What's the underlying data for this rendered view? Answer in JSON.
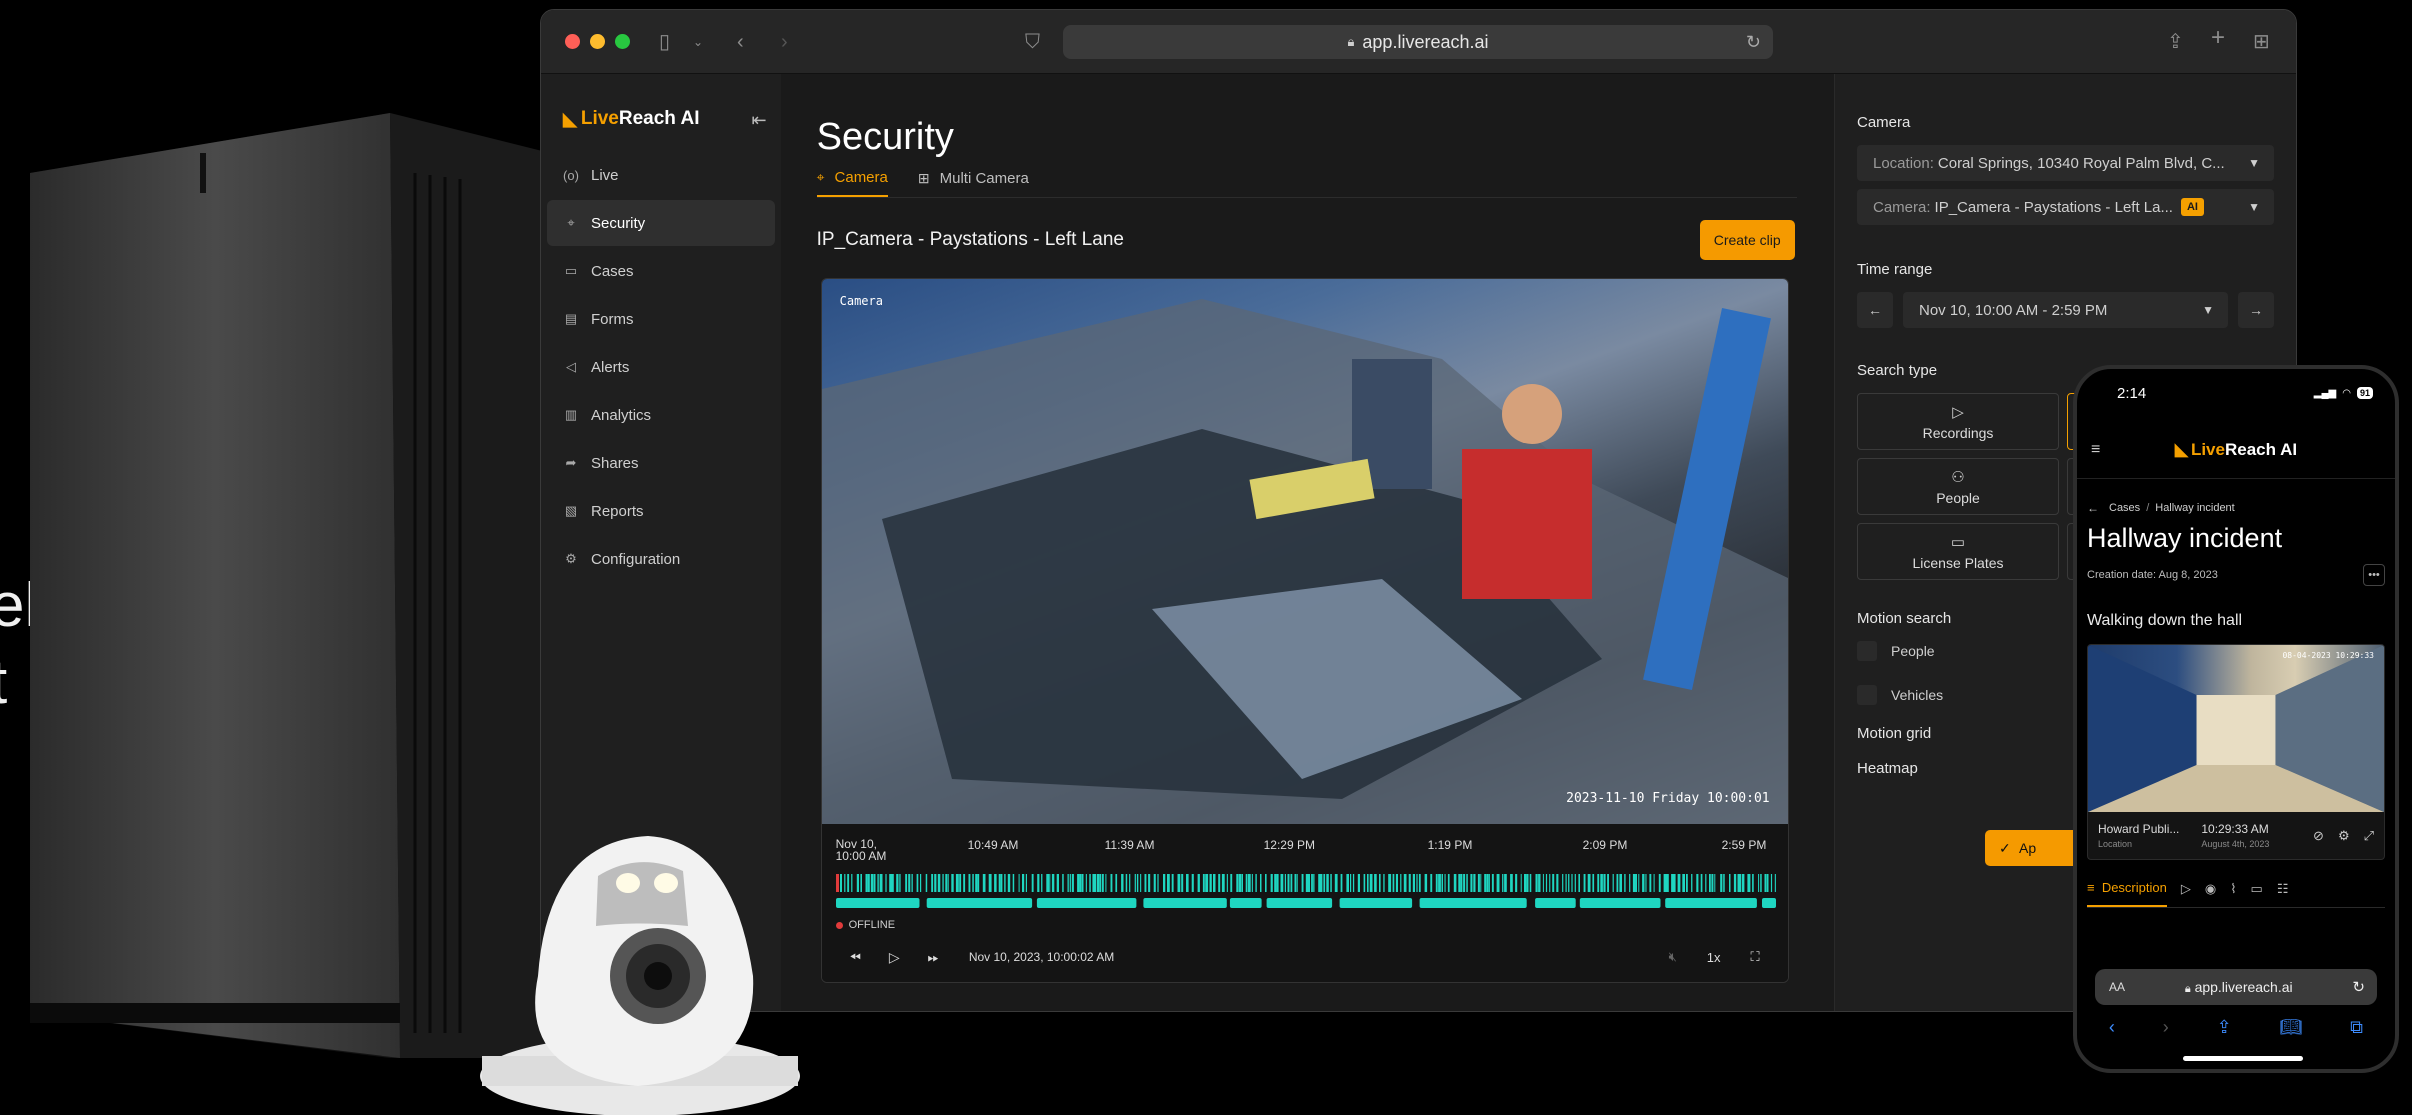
{
  "background": {
    "line1": "elle",
    "line2": "t"
  },
  "browser": {
    "url": "app.livereach.ai"
  },
  "brand": {
    "prefix": "Live",
    "suffix": "Reach AI"
  },
  "sidebar": {
    "items": [
      {
        "label": "Live",
        "icon": "live-icon",
        "glyph": "(o)"
      },
      {
        "label": "Security",
        "icon": "camera-icon",
        "glyph": "⌖",
        "active": true
      },
      {
        "label": "Cases",
        "icon": "folder-icon",
        "glyph": "▭"
      },
      {
        "label": "Forms",
        "icon": "document-icon",
        "glyph": "▤"
      },
      {
        "label": "Alerts",
        "icon": "megaphone-icon",
        "glyph": "◁"
      },
      {
        "label": "Analytics",
        "icon": "chart-icon",
        "glyph": "▥"
      },
      {
        "label": "Shares",
        "icon": "share-icon",
        "glyph": "➦"
      },
      {
        "label": "Reports",
        "icon": "report-icon",
        "glyph": "▧"
      },
      {
        "label": "Configuration",
        "icon": "gear-icon",
        "glyph": "⚙"
      }
    ]
  },
  "main": {
    "title": "Security",
    "tabs": [
      {
        "label": "Camera",
        "icon": "camera-icon",
        "active": true
      },
      {
        "label": "Multi Camera",
        "icon": "grid-icon",
        "active": false
      }
    ],
    "camera_title": "IP_Camera - Paystations - Left Lane",
    "create_clip": "Create clip",
    "video_label": "Camera",
    "video_timestamp": "2023-11-10 Friday 10:00:01",
    "timeline_ticks": [
      "Nov 10, 10:00 AM",
      "10:49 AM",
      "11:39 AM",
      "12:29 PM",
      "1:19 PM",
      "2:09 PM",
      "2:59 PM"
    ],
    "offline_label": "OFFLINE",
    "playback_time": "Nov 10, 2023, 10:00:02 AM",
    "speed": "1x",
    "colors": {
      "accent": "#f59a00",
      "activity": "#1fd6c1",
      "offline": "#e13b3b"
    }
  },
  "panel": {
    "camera_label": "Camera",
    "location_prefix": "Location:",
    "location_value": "Coral Springs, 10340 Royal Palm Blvd, C...",
    "camera_prefix": "Camera:",
    "camera_value": "IP_Camera - Paystations - Left La...",
    "ai_badge": "AI",
    "time_range_label": "Time range",
    "time_range_value": "Nov 10, 10:00 AM - 2:59 PM",
    "search_type_label": "Search type",
    "search_types": [
      {
        "label": "Recordings",
        "icon": "play-icon"
      },
      {
        "label": "People",
        "icon": "people-icon"
      },
      {
        "label": "License Plates",
        "icon": "plate-icon"
      }
    ],
    "motion_search_label": "Motion search",
    "motion_people": "People",
    "motion_vehicles": "Vehicles",
    "motion_grid": "Motion grid",
    "heatmap": "Heatmap",
    "apply_label": "Ap"
  },
  "phone": {
    "time": "2:14",
    "battery": "91",
    "brand_prefix": "Live",
    "brand_suffix": "Reach AI",
    "crumb_parent": "Cases",
    "crumb_current": "Hallway incident",
    "title": "Hallway incident",
    "creation_date": "Creation date: Aug 8, 2023",
    "section": "Walking down the hall",
    "video_stamp": "08-04-2023 10:29:33",
    "meta_location": "Howard Publi...",
    "meta_location_sub": "Location",
    "meta_time": "10:29:33 AM",
    "meta_time_sub": "August 4th, 2023",
    "tab_description": "Description",
    "url": "app.livereach.ai",
    "aa": "AA"
  }
}
